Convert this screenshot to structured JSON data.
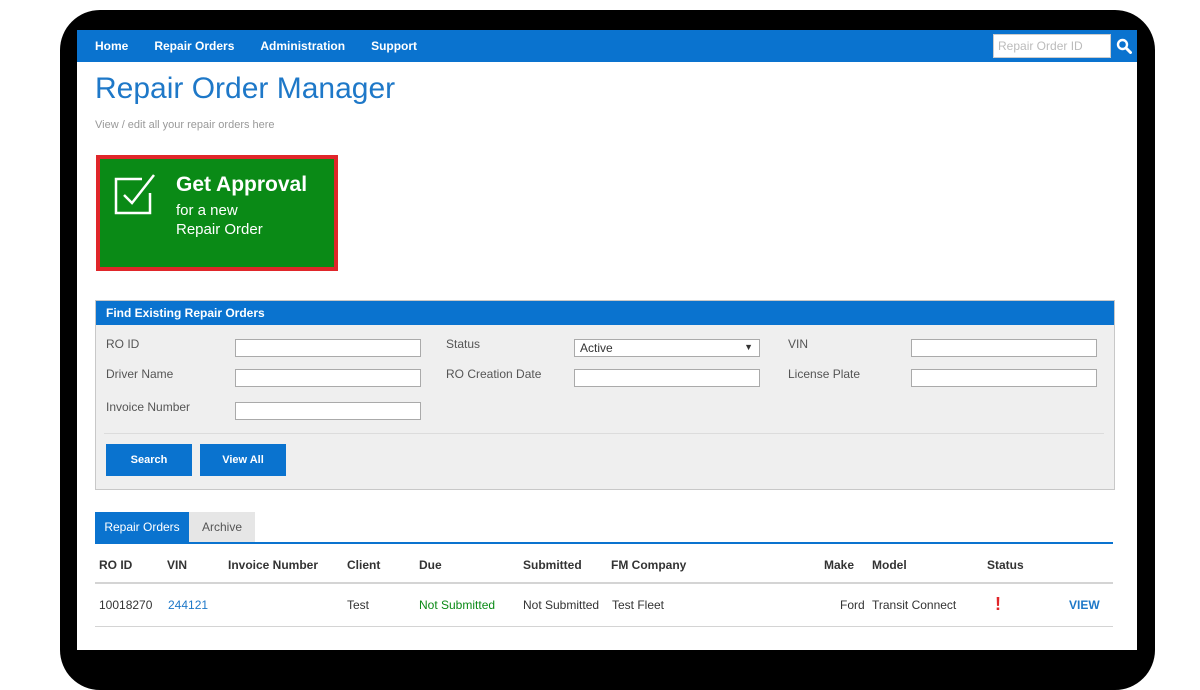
{
  "nav": {
    "items": [
      "Home",
      "Repair Orders",
      "Administration",
      "Support"
    ],
    "search_placeholder": "Repair Order ID",
    "search_icon": "search-icon"
  },
  "header": {
    "title": "Repair Order Manager",
    "subtitle": "View / edit all your repair orders here"
  },
  "approval": {
    "title": "Get Approval",
    "line1": "for a new",
    "line2": "Repair Order",
    "icon": "checkbox-check-icon"
  },
  "find": {
    "title": "Find Existing Repair Orders",
    "ro_id_label": "RO ID",
    "status_label": "Status",
    "status_value": "Active",
    "vin_label": "VIN",
    "driver_label": "Driver Name",
    "creation_label": "RO Creation Date",
    "plate_label": "License Plate",
    "invoice_label": "Invoice Number",
    "search_label": "Search",
    "viewall_label": "View All"
  },
  "tabs": [
    "Repair Orders",
    "Archive"
  ],
  "table": {
    "headers": [
      "RO ID",
      "VIN",
      "Invoice Number",
      "Client",
      "Due",
      "Submitted",
      "FM Company",
      "Make",
      "Model",
      "Status"
    ],
    "rows": [
      {
        "ro_id": "10018270",
        "vin": "244121",
        "invoice": "",
        "client": "Test",
        "due": "Not Submitted",
        "submitted": "Not Submitted",
        "fm_company": "Test Fleet",
        "make": "Ford",
        "model": "Transit Connect",
        "status_icon": "exclamation-icon",
        "status_symbol": "!",
        "action": "VIEW"
      }
    ]
  },
  "colors": {
    "primary": "#0a73cf",
    "approval_green": "#0a8a16",
    "approval_border": "#e0262a"
  }
}
